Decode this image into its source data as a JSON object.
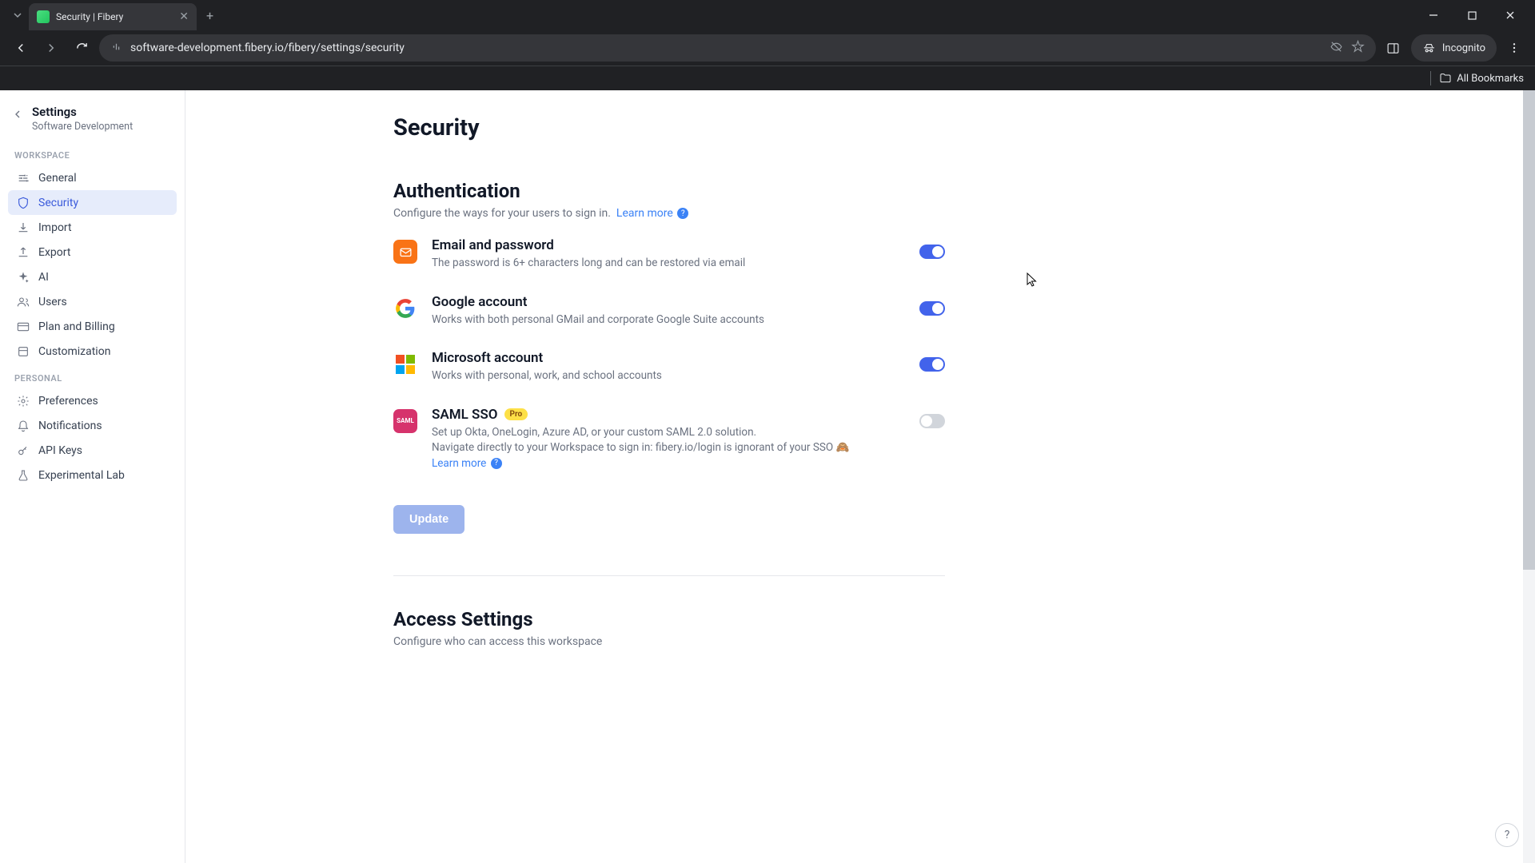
{
  "browser": {
    "tab_title": "Security | Fibery",
    "url": "software-development.fibery.io/fibery/settings/security",
    "incognito_label": "Incognito",
    "bookmarks_label": "All Bookmarks"
  },
  "sidebar": {
    "title": "Settings",
    "subtitle": "Software Development",
    "sections": {
      "workspace_label": "WORKSPACE",
      "personal_label": "PERSONAL"
    },
    "workspace_items": [
      {
        "label": "General"
      },
      {
        "label": "Security"
      },
      {
        "label": "Import"
      },
      {
        "label": "Export"
      },
      {
        "label": "AI"
      },
      {
        "label": "Users"
      },
      {
        "label": "Plan and Billing"
      },
      {
        "label": "Customization"
      }
    ],
    "personal_items": [
      {
        "label": "Preferences"
      },
      {
        "label": "Notifications"
      },
      {
        "label": "API Keys"
      },
      {
        "label": "Experimental Lab"
      }
    ]
  },
  "page": {
    "title": "Security",
    "auth": {
      "heading": "Authentication",
      "desc": "Configure the ways for your users to sign in.",
      "learn_more": "Learn more",
      "methods": {
        "email": {
          "title": "Email and password",
          "desc": "The password is 6+ characters long and can be restored via email",
          "enabled": true
        },
        "google": {
          "title": "Google account",
          "desc": "Works with both personal GMail and corporate Google Suite accounts",
          "enabled": true
        },
        "microsoft": {
          "title": "Microsoft account",
          "desc": "Works with personal, work, and school accounts",
          "enabled": true
        },
        "saml": {
          "title": "SAML SSO",
          "badge": "Pro",
          "desc1": "Set up Okta, OneLogin, Azure AD, or your custom SAML 2.0 solution.",
          "desc2": "Navigate directly to your Workspace to sign in: fibery.io/login is ignorant of your SSO 🙈",
          "learn_more": "Learn more",
          "enabled": false
        }
      },
      "update_button": "Update"
    },
    "access": {
      "heading": "Access Settings",
      "desc": "Configure who can access this workspace"
    }
  }
}
